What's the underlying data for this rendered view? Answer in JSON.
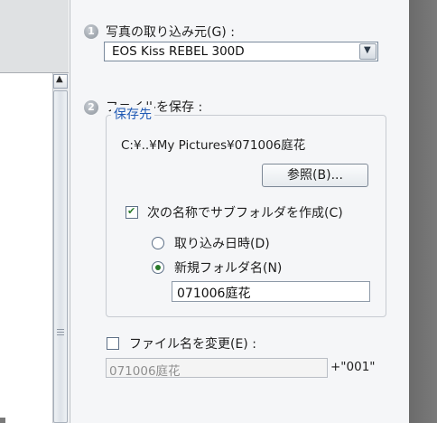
{
  "source": {
    "step": "1",
    "label": "写真の取り込み元(G) :",
    "device": "EOS Kiss REBEL 300D"
  },
  "save": {
    "step": "2",
    "label": "ファイルを保存 :",
    "group_title": "保存先",
    "path": "C:¥..¥My Pictures¥071006庭花",
    "browse_button": "参照(B)...",
    "subfolder_checkbox": {
      "label": "次の名称でサブフォルダを作成(C)",
      "checked": true
    },
    "radio_date": {
      "label": "取り込み日時(D)",
      "selected": false
    },
    "radio_new_folder": {
      "label": "新規フォルダ名(N)",
      "selected": true
    },
    "folder_name": "071006庭花"
  },
  "rename": {
    "checkbox": {
      "label": "ファイル名を変更(E) :",
      "checked": false
    },
    "value": "071006庭花",
    "suffix": "+\"001\""
  },
  "icons": {
    "scroll_up": "▲",
    "combo_arrow": "▼",
    "check_mark": "✔"
  },
  "colors": {
    "accent_blue": "#1f59b4",
    "check_green": "#2a7a2a",
    "panel_bg": "#f5f6f8"
  }
}
